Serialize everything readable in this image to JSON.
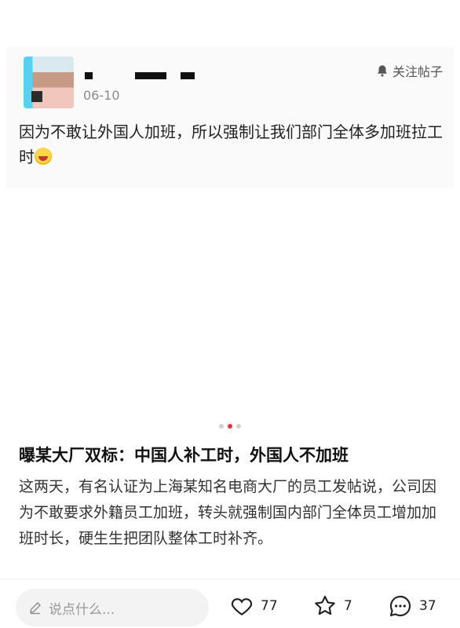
{
  "post": {
    "date": "06-10",
    "follow_label": "关注帖子",
    "text": "因为不敢让外国人加班，所以强制让我们部门全体多加班拉工时"
  },
  "carousel": {
    "count": 3,
    "active_index": 1
  },
  "article": {
    "headline": "曝某大厂双标：中国人补工时，外国人不加班",
    "summary": "这两天，有名认证为上海某知名电商大厂的员工发帖说，公司因为不敢要求外籍员工加班，转头就强制国内部门全体员工增加加班时长，硬生生把团队整体工时补齐。"
  },
  "footer": {
    "comment_placeholder": "说点什么...",
    "likes": "77",
    "favorites": "7",
    "comments": "37"
  },
  "icons": {
    "bell": "bell-icon",
    "pencil": "pencil-icon",
    "heart": "heart-icon",
    "star": "star-icon",
    "comment": "comment-bubble-icon"
  },
  "colors": {
    "active_dot": "#e8323c",
    "meta": "#8c8c8c"
  }
}
